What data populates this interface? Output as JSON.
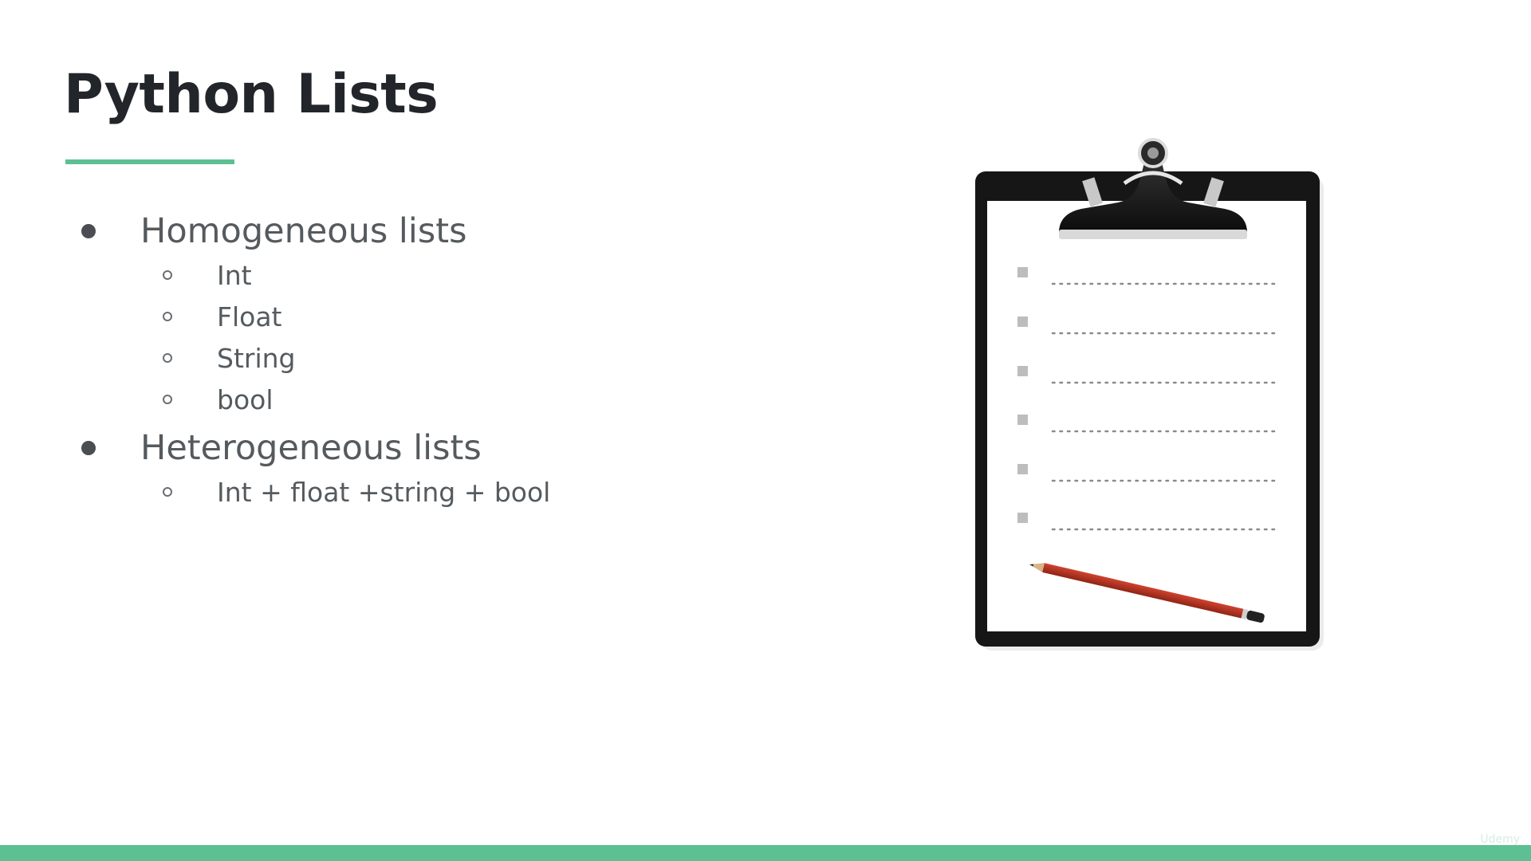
{
  "slide": {
    "title": "Python Lists",
    "accent_color": "#5cc092",
    "bullets": [
      {
        "label": "Homogeneous lists",
        "subitems": [
          "Int",
          "Float",
          "String",
          "bool"
        ]
      },
      {
        "label": "Heterogeneous lists",
        "subitems": [
          "Int + float +string + bool"
        ]
      }
    ],
    "illustration": {
      "type": "clipboard-checklist-with-pencil",
      "checklist_rows": 6
    },
    "watermark": "Udemy"
  }
}
